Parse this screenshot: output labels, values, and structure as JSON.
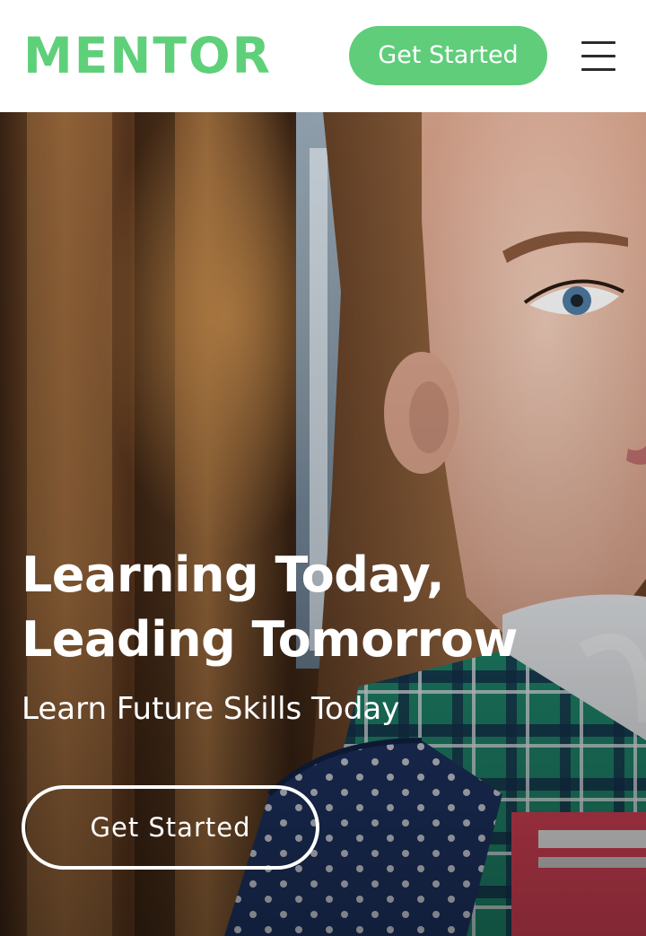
{
  "header": {
    "logo": "MENTOR",
    "cta_label": "Get Started",
    "menu_icon": "hamburger-menu-icon"
  },
  "hero": {
    "title_line1": "Learning Today,",
    "title_line2": "Leading Tomorrow",
    "subtitle": "Learn Future Skills Today",
    "cta_label": "Get Started"
  },
  "colors": {
    "accent": "#5fcd7a",
    "menu_icon": "#2b2b2b",
    "hero_text": "#ffffff"
  }
}
